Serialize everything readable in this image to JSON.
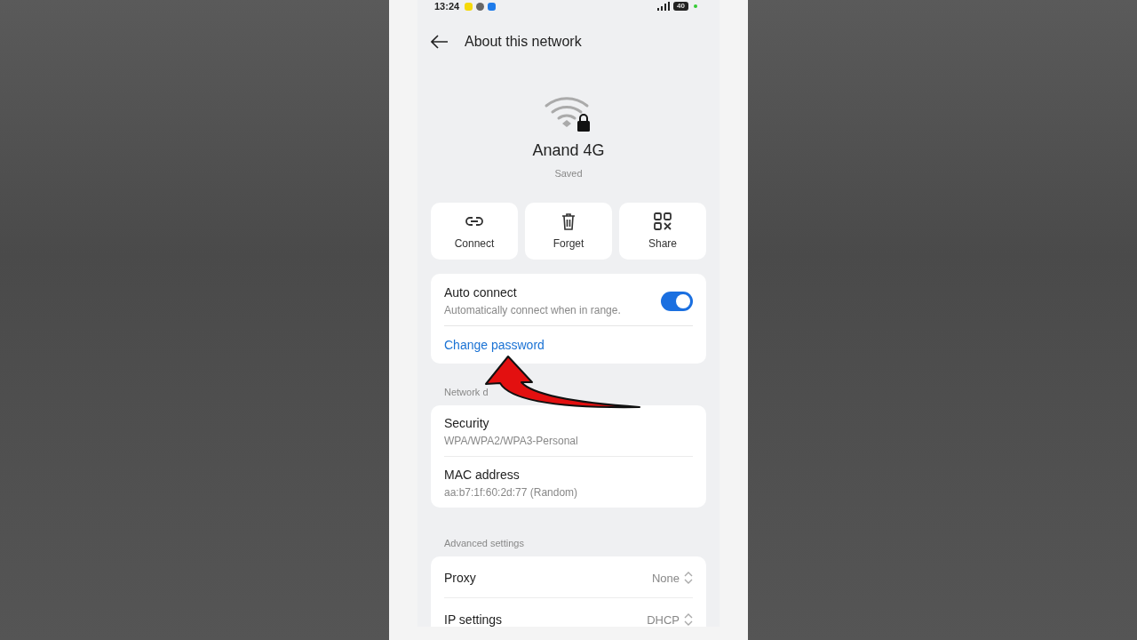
{
  "status_bar": {
    "time": "13:24",
    "battery": "40"
  },
  "header": {
    "title": "About this network"
  },
  "network": {
    "name": "Anand 4G",
    "status": "Saved"
  },
  "actions": [
    {
      "kind": "link",
      "label": "Connect"
    },
    {
      "kind": "trash",
      "label": "Forget"
    },
    {
      "kind": "qr",
      "label": "Share"
    }
  ],
  "auto_connect": {
    "title": "Auto connect",
    "description": "Automatically connect when in range.",
    "on": true
  },
  "change_password": "Change password",
  "sections": [
    {
      "heading": "Network d",
      "rows": [
        {
          "kind": "info",
          "label": "Security",
          "value": "WPA/WPA2/WPA3-Personal"
        },
        {
          "kind": "info",
          "label": "MAC address",
          "value": "aa:b7:1f:60:2d:77 (Random)"
        }
      ]
    },
    {
      "heading": "Advanced settings",
      "rows": [
        {
          "kind": "select",
          "label": "Proxy",
          "value": "None"
        },
        {
          "kind": "select",
          "label": "IP settings",
          "value": "DHCP"
        }
      ]
    }
  ]
}
